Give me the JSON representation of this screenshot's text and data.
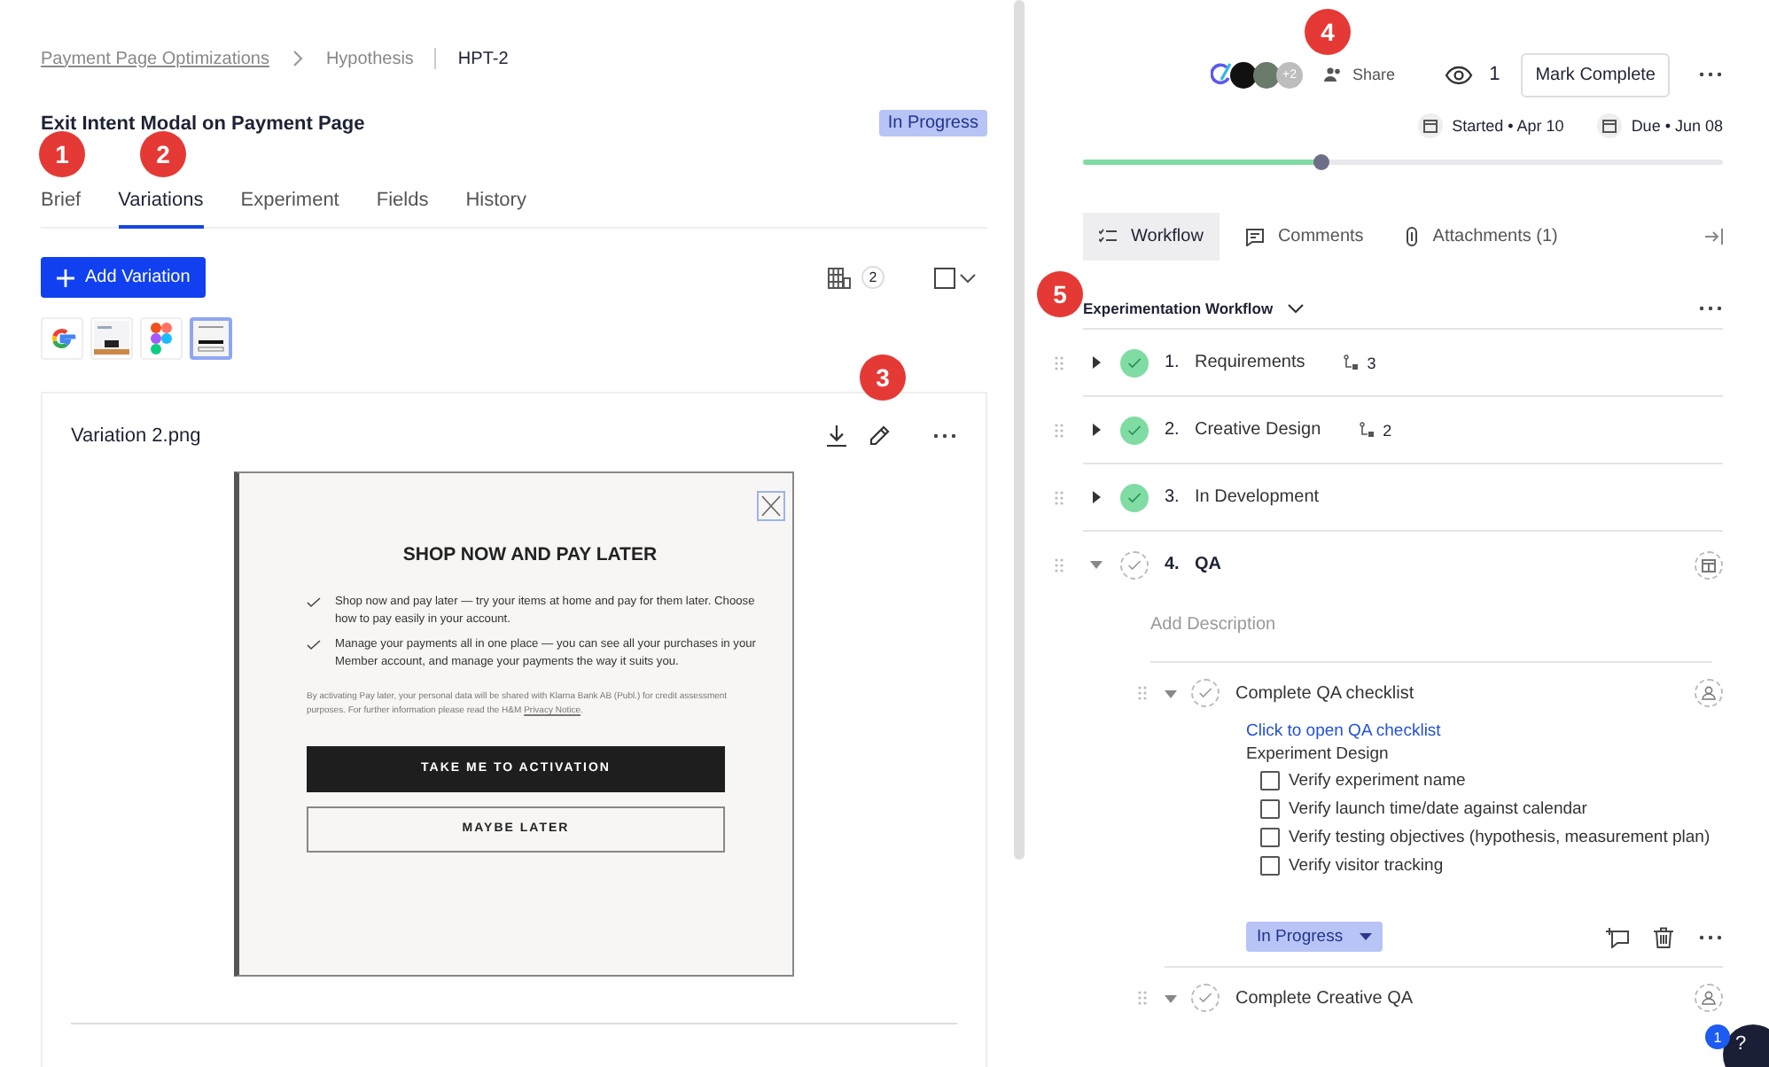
{
  "breadcrumb": [
    {
      "label": "Payment Page Optimizations",
      "kind": "link"
    },
    {
      "label": "Hypothesis",
      "kind": "crumb"
    },
    {
      "label": "HPT-2",
      "kind": "current"
    }
  ],
  "title": "Exit Intent Modal on Payment Page",
  "status_badge": "In Progress",
  "tabs": [
    {
      "label": "Brief",
      "selected": false
    },
    {
      "label": "Variations",
      "selected": true
    },
    {
      "label": "Experiment",
      "selected": false
    },
    {
      "label": "Fields",
      "selected": false
    },
    {
      "label": "History",
      "selected": false
    }
  ],
  "add_button": "Add Variation",
  "variation_count": "2",
  "thumbnails": [
    {
      "kind": "google",
      "selected": false
    },
    {
      "kind": "screenshot",
      "selected": false
    },
    {
      "kind": "figma",
      "selected": false
    },
    {
      "kind": "modal",
      "selected": true
    }
  ],
  "variation": {
    "filename": "Variation 2.png",
    "preview": {
      "heading": "SHOP NOW AND PAY LATER",
      "bullets": [
        "Shop now and pay later — try your items at home and pay for them later. Choose how to pay easily in your account.",
        "Manage your payments all in one place — you can see all your purchases in your Member account, and manage your payments the way it suits you."
      ],
      "disclaimer": {
        "before": "By activating Pay later, your personal data will be shared with Klarna Bank AB (Publ.) for credit assessment purposes. For further information please read the H&M",
        "link": "Privacy Notice",
        "after": "."
      },
      "primary_button": "TAKE ME TO ACTIVATION",
      "secondary_button": "MAYBE LATER"
    }
  },
  "annotations": [
    "1",
    "2",
    "3",
    "4",
    "5"
  ],
  "header": {
    "more_people": "+2",
    "share": "Share",
    "watchers": "1",
    "mark_complete": "Mark Complete",
    "started": "Started • Apr 10",
    "due": "Due • Jun 08",
    "progress": {
      "level": 0.37
    }
  },
  "panel_tabs": [
    {
      "label": "Workflow",
      "kind": "workflow",
      "selected": true
    },
    {
      "label": "Comments",
      "kind": "comments",
      "selected": false
    },
    {
      "label": "Attachments (1)",
      "kind": "attachments",
      "selected": false
    }
  ],
  "workflow": {
    "title": "Experimentation Workflow",
    "steps": [
      {
        "number": "1.",
        "name": "Requirements",
        "done": true,
        "expanded": false,
        "subtasks": "3"
      },
      {
        "number": "2.",
        "name": "Creative Design",
        "done": true,
        "expanded": false,
        "subtasks": "2"
      },
      {
        "number": "3.",
        "name": "In Development",
        "done": true,
        "expanded": false
      },
      {
        "number": "4.",
        "name": "QA",
        "done": false,
        "expanded": true,
        "description_placeholder": "Add Description",
        "tasks": [
          {
            "name": "Complete QA checklist",
            "done": false,
            "expanded": true,
            "link": "Click to open QA checklist",
            "section": "Experiment Design",
            "checklist": [
              {
                "label": "Verify experiment name",
                "checked": false
              },
              {
                "label": "Verify launch time/date against calendar",
                "checked": false
              },
              {
                "label": "Verify testing objectives (hypothesis, measurement plan)",
                "checked": false
              },
              {
                "label": "Verify visitor tracking",
                "checked": false
              }
            ],
            "status": "In Progress"
          },
          {
            "name": "Complete Creative QA",
            "done": false,
            "expanded": true
          }
        ]
      }
    ]
  },
  "help": {
    "badge": "1",
    "label": "?"
  }
}
